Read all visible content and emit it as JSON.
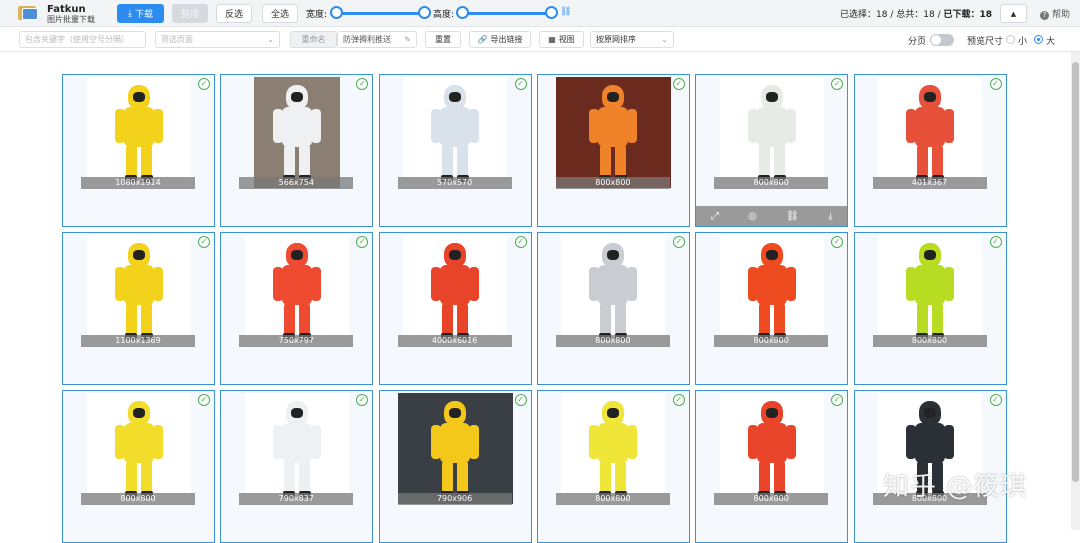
{
  "app": {
    "name": "Fatkun",
    "subtitle": "图片批量下载"
  },
  "toolbar": {
    "download": "下载",
    "dedupe": "整理",
    "invert": "反选",
    "select_all": "全选",
    "width_label": "宽度:",
    "height_label": "高度:",
    "status_prefix": "已选择：18 / 总共：18 / ",
    "status_downloaded": "已下载：18",
    "help": "帮助"
  },
  "filters": {
    "keyword_placeholder": "包含关键字（使用空号分隔）",
    "page_filter_placeholder": "筛选页面",
    "rename": "重命名",
    "rename_value": "防弹褥利推送",
    "reset": "重置",
    "export_links": "导出链接",
    "view": "视图",
    "sort": "按原网排序",
    "paging": "分页",
    "preview_size": "预览尺寸",
    "size_small": "小",
    "size_large": "大"
  },
  "images": [
    {
      "dims": "1080x1914",
      "color": "#f2d21a"
    },
    {
      "dims": "566x754",
      "color": "#eef0f2"
    },
    {
      "dims": "570x570",
      "color": "#d9e2ea"
    },
    {
      "dims": "800x800",
      "color": "#f0832a"
    },
    {
      "dims": "800x800",
      "color": "#e6ebe6"
    },
    {
      "dims": "401x367",
      "color": "#e7513a"
    },
    {
      "dims": "1100x1369",
      "color": "#f2d21a"
    },
    {
      "dims": "750x797",
      "color": "#ee4b30"
    },
    {
      "dims": "4000x6016",
      "color": "#e8442a"
    },
    {
      "dims": "800x800",
      "color": "#c9ccd1"
    },
    {
      "dims": "800x800",
      "color": "#ee4b20"
    },
    {
      "dims": "800x800",
      "color": "#b8dc22"
    },
    {
      "dims": "800x800",
      "color": "#f2dd2a"
    },
    {
      "dims": "790x837",
      "color": "#eef1f4"
    },
    {
      "dims": "790x906",
      "color": "#f4c81a"
    },
    {
      "dims": "800x800",
      "color": "#efe637"
    },
    {
      "dims": "800x800",
      "color": "#e8442a"
    },
    {
      "dims": "800x800",
      "color": "#2b2f36"
    }
  ],
  "watermark": "知乎 @筱琪",
  "accent_color": "#2d8cf0"
}
